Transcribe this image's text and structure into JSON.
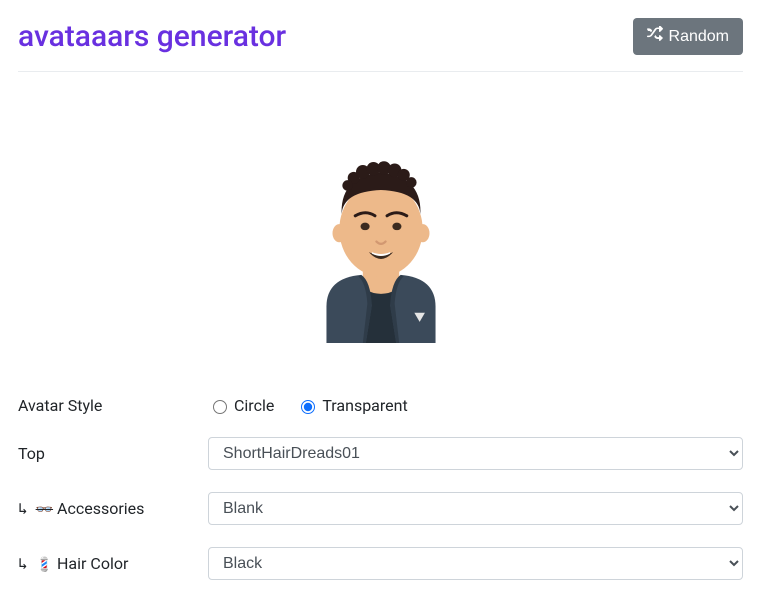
{
  "header": {
    "title": "avataaars generator",
    "random_label": "Random"
  },
  "form": {
    "avatar_style": {
      "label": "Avatar Style",
      "options": {
        "circle": "Circle",
        "transparent": "Transparent"
      },
      "selected": "transparent"
    },
    "top": {
      "label": "Top",
      "value": "ShortHairDreads01"
    },
    "accessories": {
      "prefix": "↳",
      "icon": "👓",
      "label": "Accessories",
      "value": "Blank"
    },
    "hair_color": {
      "prefix": "↳",
      "icon": "💈",
      "label": "Hair Color",
      "value": "Black"
    }
  }
}
